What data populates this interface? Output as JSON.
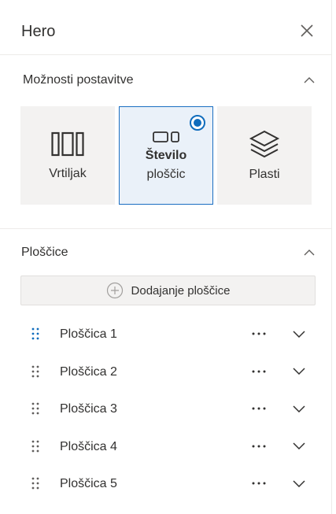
{
  "panel": {
    "title": "Hero"
  },
  "layout_section": {
    "title": "Možnosti postavitve",
    "options": [
      {
        "label_lines": [
          "Vrtiljak"
        ],
        "icon": "carousel-icon",
        "selected": false
      },
      {
        "label_lines": [
          "Število",
          "ploščic"
        ],
        "icon": "tiles-icon",
        "selected": true
      },
      {
        "label_lines": [
          "Plasti"
        ],
        "icon": "layers-icon",
        "selected": false
      }
    ]
  },
  "tiles_section": {
    "title": "Ploščice",
    "add_label": "Dodajanje ploščice",
    "items": [
      {
        "label": "Ploščica 1"
      },
      {
        "label": "Ploščica 2"
      },
      {
        "label": "Ploščica 3"
      },
      {
        "label": "Ploščica 4"
      },
      {
        "label": "Ploščica 5"
      }
    ]
  },
  "colors": {
    "accent": "#0f6cbd",
    "option_bg": "#f3f2f1",
    "selected_border": "#1b6ec2"
  },
  "icons": {
    "close": "close-icon",
    "collapse": "chevron-up-icon",
    "add": "plus-circle-icon",
    "drag": "drag-handle-icon",
    "more": "more-icon",
    "expand": "chevron-down-icon"
  }
}
